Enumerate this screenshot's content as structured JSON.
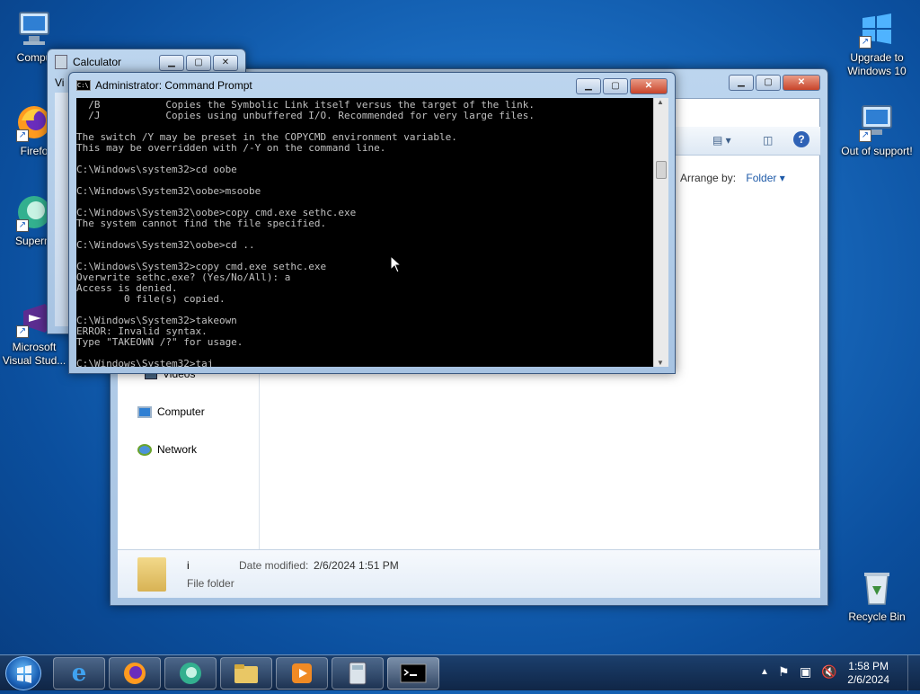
{
  "desktop": {
    "icons_left": [
      {
        "label": "Compu",
        "icon": "computer-icon"
      },
      {
        "label": "Firefo",
        "icon": "firefox-icon"
      },
      {
        "label": "Superm",
        "icon": "app-icon"
      },
      {
        "label": "Microsoft Visual Stud...",
        "icon": "visual-studio-icon"
      }
    ],
    "icons_right": [
      {
        "label": "Upgrade to Windows 10",
        "icon": "windows-logo-icon"
      },
      {
        "label": "Out of support!",
        "icon": "computer-warning-icon"
      },
      {
        "label": "Recycle Bin",
        "icon": "recycle-bin-icon"
      }
    ]
  },
  "calculator": {
    "title": "Calculator",
    "menu_fragment": "Vi"
  },
  "explorer": {
    "arrange_label": "Arrange by:",
    "arrange_value": "Folder",
    "nav": [
      "Videos",
      "Computer",
      "Network"
    ],
    "details": {
      "name": "i",
      "type": "File folder",
      "date_label": "Date modified:",
      "date_value": "2/6/2024 1:51 PM"
    }
  },
  "cmd": {
    "title": "Administrator: Command Prompt",
    "lines": [
      "  /B           Copies the Symbolic Link itself versus the target of the link.",
      "  /J           Copies using unbuffered I/O. Recommended for very large files.",
      "",
      "The switch /Y may be preset in the COPYCMD environment variable.",
      "This may be overridden with /-Y on the command line.",
      "",
      "C:\\Windows\\system32>cd oobe",
      "",
      "C:\\Windows\\System32\\oobe>msoobe",
      "",
      "C:\\Windows\\System32\\oobe>copy cmd.exe sethc.exe",
      "The system cannot find the file specified.",
      "",
      "C:\\Windows\\System32\\oobe>cd ..",
      "",
      "C:\\Windows\\System32>copy cmd.exe sethc.exe",
      "Overwrite sethc.exe? (Yes/No/All): a",
      "Access is denied.",
      "        0 file(s) copied.",
      "",
      "C:\\Windows\\System32>takeown",
      "ERROR: Invalid syntax.",
      "Type \"TAKEOWN /?\" for usage.",
      "",
      "C:\\Windows\\System32>taj"
    ]
  },
  "taskbar": {
    "items": [
      {
        "name": "internet-explorer",
        "icon": "ie-icon"
      },
      {
        "name": "firefox",
        "icon": "firefox-icon"
      },
      {
        "name": "app",
        "icon": "app-icon"
      },
      {
        "name": "explorer",
        "icon": "folder-icon"
      },
      {
        "name": "media-player",
        "icon": "media-icon"
      },
      {
        "name": "calculator",
        "icon": "calculator-icon"
      },
      {
        "name": "command-prompt",
        "icon": "cmd-icon"
      }
    ],
    "time": "1:58 PM",
    "date": "2/6/2024"
  }
}
